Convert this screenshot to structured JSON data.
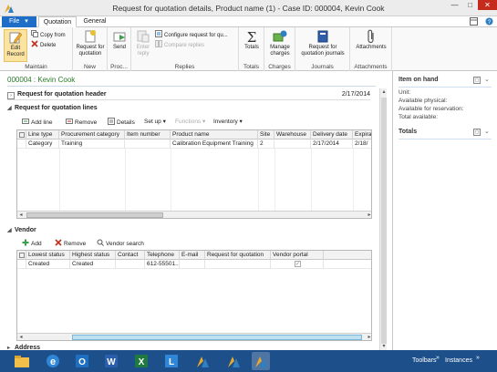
{
  "window": {
    "title": "Request for quotation details, Product name (1) - Case ID: 000004, Kevin Cook",
    "min": "—",
    "max": "□",
    "close": "✕"
  },
  "tabs": {
    "file": "File",
    "file_arrow": "▾",
    "quotation": "Quotation",
    "general": "General"
  },
  "ribbon": {
    "maintain": {
      "label": "Maintain",
      "edit_record_line1": "Edit",
      "edit_record_line2": "Record",
      "copy_from": "Copy from",
      "delete": "Delete"
    },
    "new": {
      "label": "New",
      "line1": "Request for",
      "line2": "quotation"
    },
    "proc": {
      "label": "Proc...",
      "send": "Send"
    },
    "replies": {
      "label": "Replies",
      "enter_reply_line1": "Enter",
      "enter_reply_line2": "reply",
      "configure": "Configure request for qu...",
      "compare": "Compare replies"
    },
    "totals": {
      "label": "Totals",
      "totals": "Totals"
    },
    "charges": {
      "label": "Charges",
      "line1": "Manage",
      "line2": "charges"
    },
    "journals": {
      "label": "Journals",
      "line1": "Request for",
      "line2": "quotation journals"
    },
    "attachments": {
      "label": "Attachments",
      "attachments": "Attachments"
    }
  },
  "record": {
    "title": "000004 : Kevin Cook"
  },
  "header_section": {
    "label": "Request for quotation header",
    "date": "2/17/2014"
  },
  "lines_section": {
    "label": "Request for quotation lines",
    "toolbar": {
      "add_line": "Add line",
      "remove": "Remove",
      "details": "Details",
      "setup": "Set up ▾",
      "functions": "Functions ▾",
      "inventory": "Inventory ▾"
    },
    "columns": [
      "Line type",
      "Procurement category",
      "Item number",
      "Product name",
      "Site",
      "Warehouse",
      "Delivery date",
      "Expira"
    ],
    "rows": [
      [
        "Category",
        "Training",
        "",
        "Calibration Equipment Training",
        "2",
        "",
        "2/17/2014",
        "2/18/"
      ]
    ]
  },
  "vendor_section": {
    "label": "Vendor",
    "toolbar": {
      "add": "Add",
      "remove": "Remove",
      "vendor_search": "Vendor search"
    },
    "columns": [
      "Lowest status",
      "Highest status",
      "Contact",
      "Telephone",
      "E-mail",
      "Request for quotation",
      "Vendor portal"
    ],
    "rows": [
      [
        "Created",
        "Created",
        "",
        "612-55501...",
        "",
        "",
        "✓"
      ]
    ]
  },
  "address_section": {
    "label": "Address"
  },
  "right_pane": {
    "item_on_hand": {
      "title": "Item on hand",
      "unit": "Unit:",
      "available_physical": "Available physical:",
      "available_reservation": "Available for reservation:",
      "total_available": "Total available:"
    },
    "totals": {
      "title": "Totals"
    }
  },
  "taskbar": {
    "toolbars": "Toolbars",
    "instances": "Instances",
    "chevrons": "»"
  },
  "colors": {
    "accent": "#1e6ec8",
    "record_title": "#2a7a2a",
    "taskbar": "#1d4f8a",
    "close": "#c42b1c"
  }
}
